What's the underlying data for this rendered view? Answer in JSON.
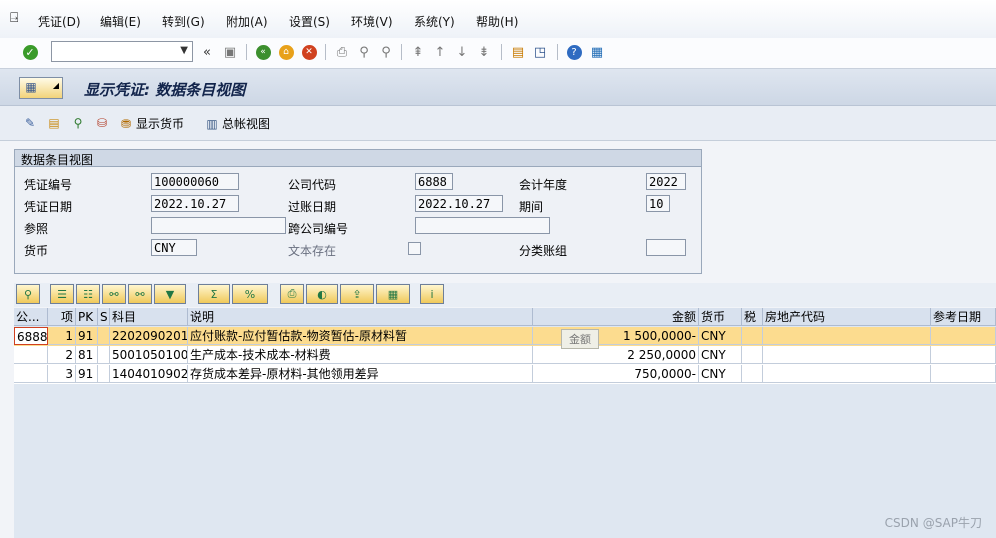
{
  "menu": [
    "凭证(D)",
    "编辑(E)",
    "转到(G)",
    "附加(A)",
    "设置(S)",
    "环境(V)",
    "系统(Y)",
    "帮助(H)"
  ],
  "toolbar": {
    "command_field_value": ""
  },
  "title": "显示凭证: 数据条目视图",
  "app_toolbar": {
    "show_currency": "显示货币",
    "general_ledger_view": "总帐视图"
  },
  "group": {
    "title": "数据条目视图",
    "doc_number_label": "凭证编号",
    "doc_number": "100000060",
    "company_code_label": "公司代码",
    "company_code": "6888",
    "fiscal_year_label": "会计年度",
    "fiscal_year": "2022",
    "doc_date_label": "凭证日期",
    "doc_date": "2022.10.27",
    "posting_date_label": "过账日期",
    "posting_date": "2022.10.27",
    "period_label": "期间",
    "period": "10",
    "reference_label": "参照",
    "reference": "",
    "cross_company_label": "跨公司编号",
    "cross_company": "",
    "currency_label": "货币",
    "currency": "CNY",
    "text_exists_label": "文本存在",
    "ledger_group_label": "分类账组",
    "ledger_group": ""
  },
  "grid": {
    "headers": [
      "公...",
      "项",
      "PK",
      "S",
      "科目",
      "说明",
      "金额",
      "货币",
      "税",
      "房地产代码",
      "参考日期"
    ],
    "rows": [
      {
        "company": "6888",
        "item": "1",
        "pk": "91",
        "s": "",
        "account": "2202090201",
        "text": "应付账款-应付暂估款-物资暂估-原材料暂",
        "amount": "1 500,0000-",
        "currency": "CNY"
      },
      {
        "company": "",
        "item": "2",
        "pk": "81",
        "s": "",
        "account": "5001050100",
        "text": "生产成本-技术成本-材料费",
        "amount": "2 250,0000",
        "currency": "CNY"
      },
      {
        "company": "",
        "item": "3",
        "pk": "91",
        "s": "",
        "account": "1404010902",
        "text": "存货成本差异-原材料-其他领用差异",
        "amount": "750,0000-",
        "currency": "CNY"
      }
    ]
  },
  "tooltip": "金额",
  "watermark": "CSDN @SAP牛刀"
}
